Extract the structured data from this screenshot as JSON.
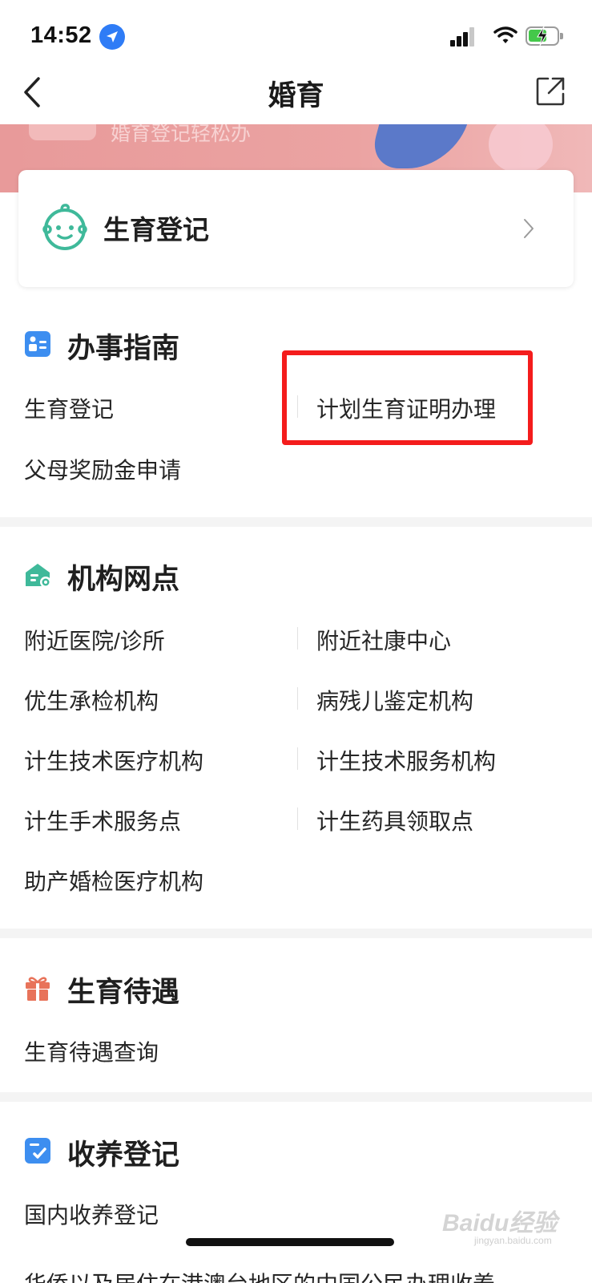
{
  "status_bar": {
    "time": "14:52"
  },
  "nav": {
    "title": "婚育"
  },
  "banner": {
    "subtitle": "婚育登记轻松办"
  },
  "card": {
    "title": "生育登记"
  },
  "guide": {
    "title": "办事指南",
    "items": [
      "生育登记",
      "计划生育证明办理",
      "父母奖励金申请"
    ]
  },
  "institutions": {
    "title": "机构网点",
    "items": [
      "附近医院/诊所",
      "附近社康中心",
      "优生承检机构",
      "病残儿鉴定机构",
      "计生技术医疗机构",
      "计生技术服务机构",
      "计生手术服务点",
      "计生药具领取点",
      "助产婚检医疗机构"
    ]
  },
  "benefits": {
    "title": "生育待遇",
    "items": [
      "生育待遇查询"
    ]
  },
  "adoption": {
    "title": "收养登记",
    "items": [
      "国内收养登记",
      "华侨以及居住在港澳台地区的中国公民办理收养"
    ]
  },
  "watermark": {
    "logo": "Baidu经验",
    "url": "jingyan.baidu.com"
  },
  "colors": {
    "highlight": "#f41c1c",
    "guide_icon": "#3d8ef0",
    "institution_icon": "#3fb99a",
    "benefit_icon": "#e8735a",
    "adoption_icon": "#3d8ef0"
  }
}
